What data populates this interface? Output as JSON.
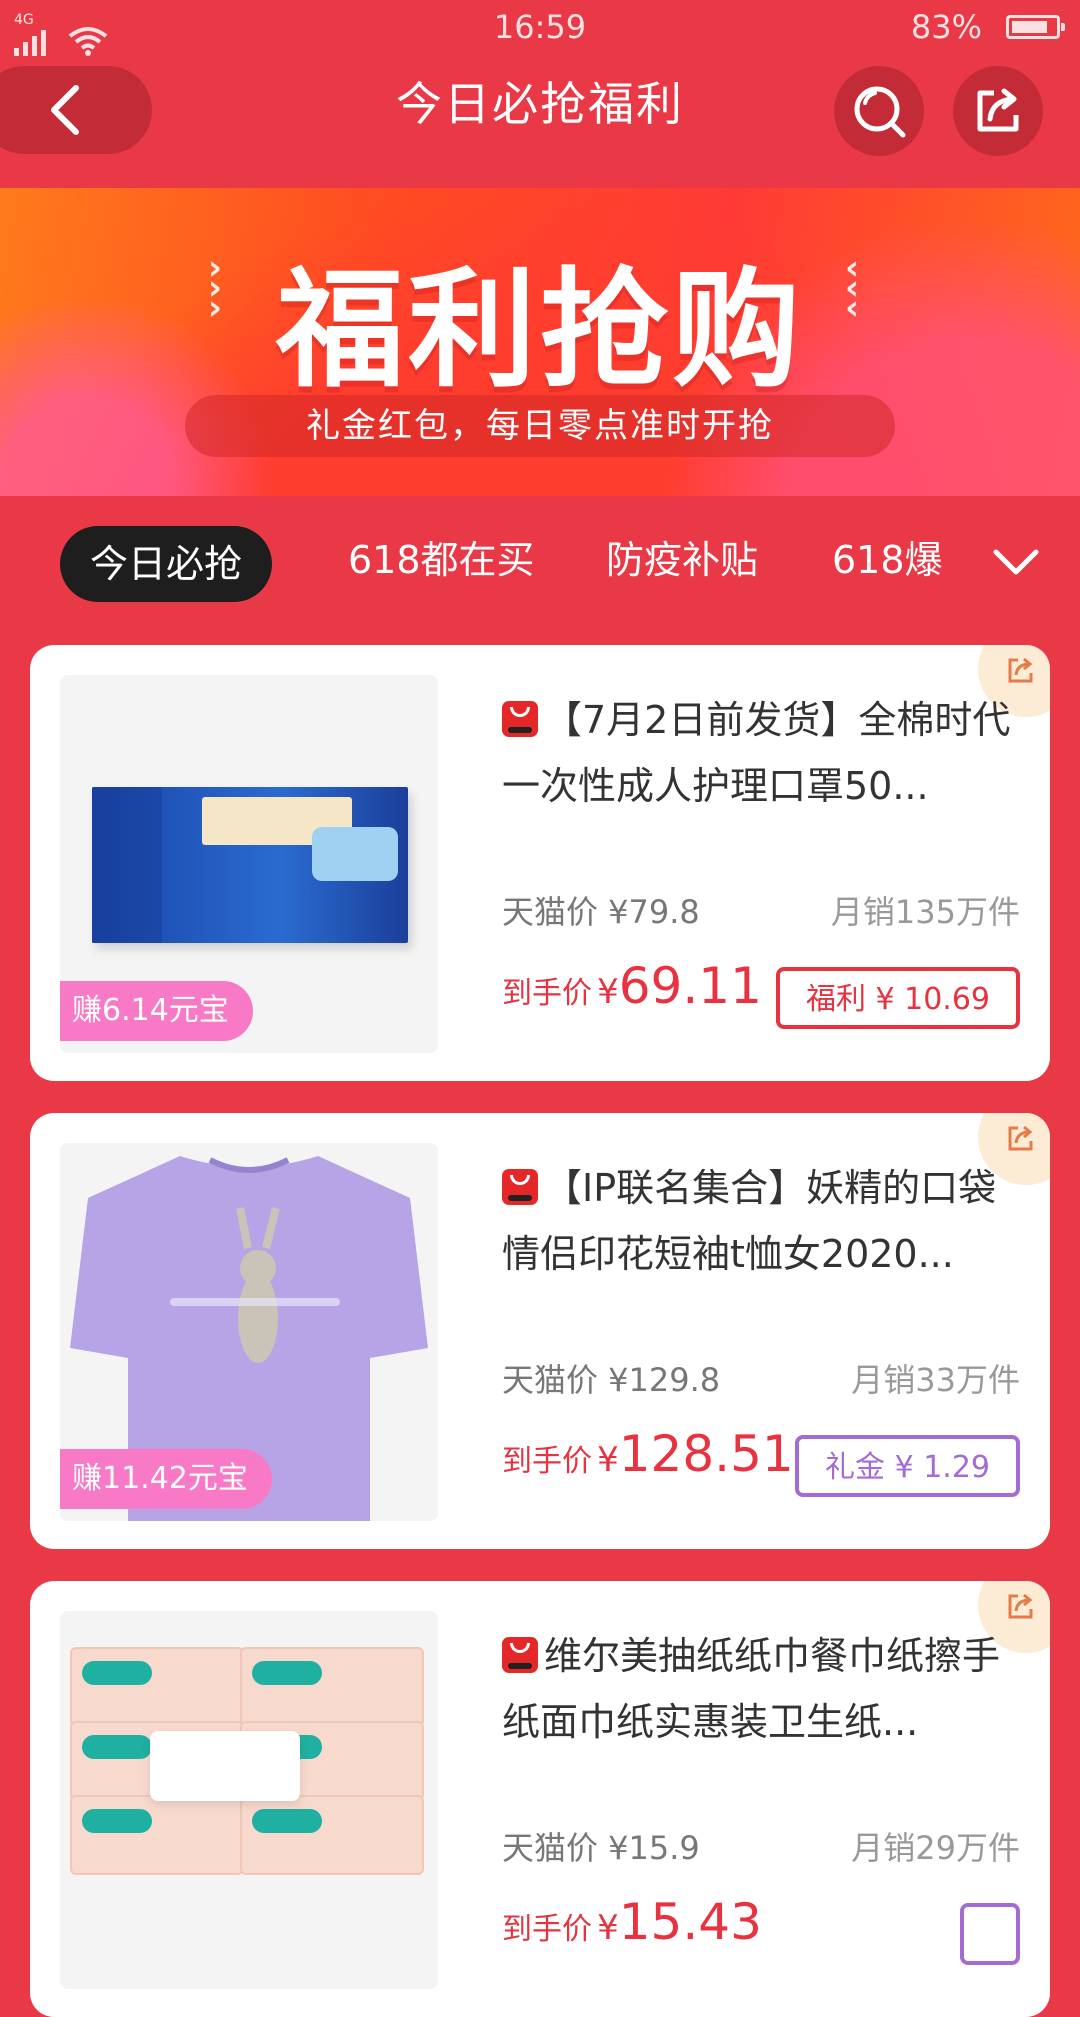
{
  "status_bar": {
    "network": "4G",
    "time": "16:59",
    "battery_text": "83%",
    "battery_level": 0.83
  },
  "header": {
    "title": "今日必抢福利"
  },
  "banner": {
    "title": "福利抢购",
    "subtitle": "礼金红包，每日零点准时开抢"
  },
  "tabs": [
    {
      "label": "今日必抢",
      "active": true
    },
    {
      "label": "618都在买",
      "active": false
    },
    {
      "label": "防疫补贴",
      "active": false
    },
    {
      "label": "618爆",
      "active": false
    }
  ],
  "products": [
    {
      "title": "【7月2日前发货】全棉时代一次性成人护理口罩50...",
      "tmall_price": "天猫价 ¥79.8",
      "monthly_sales": "月销135万件",
      "final_label": "到手价",
      "currency": "¥",
      "final_price": "69.11",
      "coupon": "福利 ¥ 10.69",
      "coupon_color": "#e8323f",
      "earn": "赚6.14元宝"
    },
    {
      "title": "【IP联名集合】妖精的口袋情侣印花短袖t恤女2020...",
      "tmall_price": "天猫价 ¥129.8",
      "monthly_sales": "月销33万件",
      "final_label": "到手价",
      "currency": "¥",
      "final_price": "128.51",
      "coupon": "礼金 ¥ 1.29",
      "coupon_color": "#a46bd3",
      "earn": "赚11.42元宝"
    },
    {
      "title": "维尔美抽纸纸巾餐巾纸擦手纸面巾纸实惠装卫生纸...",
      "tmall_price": "天猫价 ¥15.9",
      "monthly_sales": "月销29万件",
      "final_label": "到手价",
      "currency": "¥",
      "final_price": "15.43",
      "coupon": "",
      "earn": ""
    }
  ],
  "colors": {
    "background": "#e93846",
    "price_red": "#e8323f",
    "accent_purple": "#a46bd3",
    "earn_pink": "#f87ac6"
  }
}
